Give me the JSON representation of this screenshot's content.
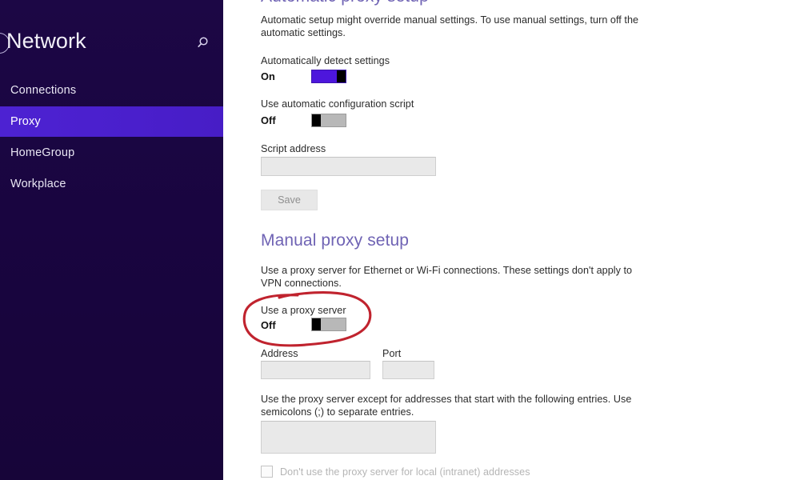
{
  "sidebar": {
    "title": "Network",
    "back_icon": "back-arrow-icon",
    "search_icon": "search-icon",
    "items": [
      {
        "label": "Connections",
        "selected": false
      },
      {
        "label": "Proxy",
        "selected": true
      },
      {
        "label": "HomeGroup",
        "selected": false
      },
      {
        "label": "Workplace",
        "selected": false
      }
    ],
    "colors": {
      "background": "#190540",
      "selected": "#4a1fcc",
      "text": "#e9e6f3"
    }
  },
  "main": {
    "automatic_setup": {
      "heading": "Automatic proxy setup",
      "description": "Automatic setup might override manual settings. To use manual settings, turn off the automatic settings.",
      "auto_detect": {
        "label": "Automatically detect settings",
        "state": "On",
        "on": true
      },
      "auto_script": {
        "label": "Use automatic configuration script",
        "state": "Off",
        "on": false
      },
      "script_address": {
        "label": "Script address",
        "value": "",
        "placeholder": ""
      },
      "save_label": "Save"
    },
    "manual_setup": {
      "heading": "Manual proxy setup",
      "description": "Use a proxy server for Ethernet or Wi-Fi connections. These settings don't apply to VPN connections.",
      "use_proxy": {
        "label": "Use a proxy server",
        "state": "Off",
        "on": false
      },
      "address": {
        "label": "Address",
        "value": "",
        "placeholder": ""
      },
      "port": {
        "label": "Port",
        "value": "",
        "placeholder": ""
      },
      "exceptions_description": "Use the proxy server except for addresses that start with the following entries. Use semicolons (;) to separate entries.",
      "exceptions": {
        "value": "",
        "placeholder": ""
      },
      "local_addresses": {
        "label": "Don't use the proxy server for local (intranet) addresses",
        "checked": false
      }
    },
    "colors": {
      "heading": "#6f63b4",
      "toggle_on": "#4d16dc",
      "toggle_off": "#b8b8b8",
      "input_background": "#e9e9e9"
    }
  },
  "annotation": {
    "shape": "hand-drawn-ellipse",
    "color": "#c0232e",
    "target": "Use a proxy server"
  }
}
